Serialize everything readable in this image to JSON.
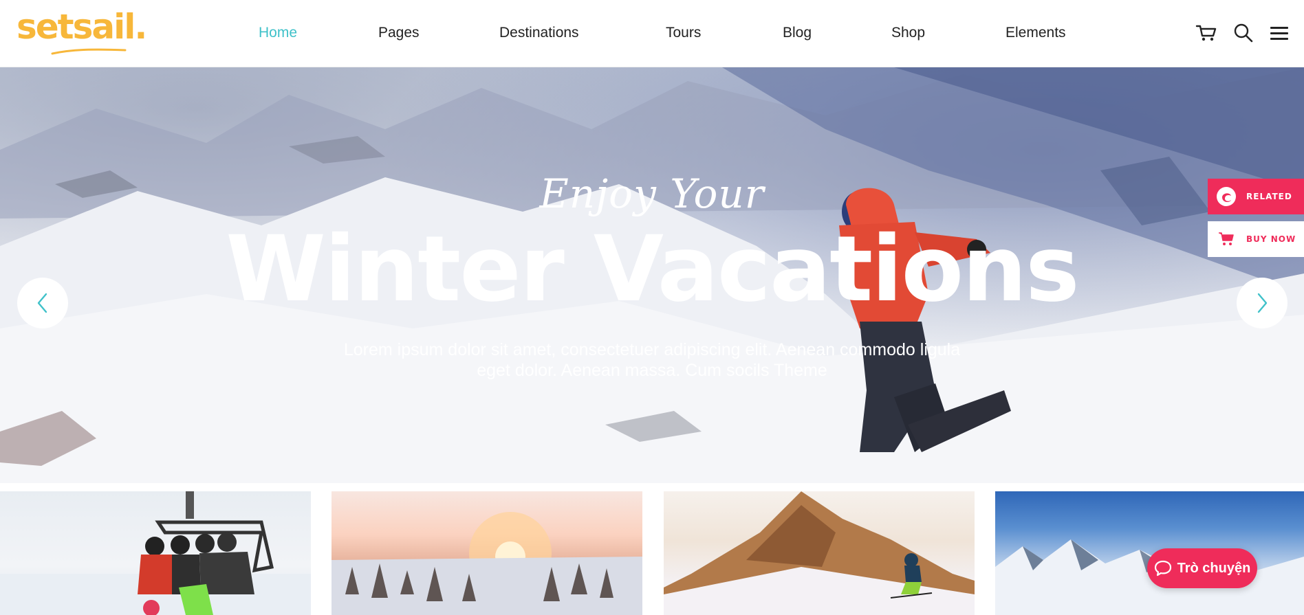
{
  "brand": {
    "logo_text": "setsail."
  },
  "nav": {
    "items": [
      {
        "label": "Home",
        "active": true
      },
      {
        "label": "Pages"
      },
      {
        "label": "Destinations"
      },
      {
        "label": "Tours"
      },
      {
        "label": "Blog"
      },
      {
        "label": "Shop"
      },
      {
        "label": "Elements"
      }
    ],
    "icons": [
      "cart-icon",
      "search-icon",
      "hamburger-menu-icon"
    ]
  },
  "hero": {
    "script_line": "Enjoy Your",
    "title": "Winter Vacations",
    "description_line1": "Lorem ipsum dolor sit amet, consectetuer adipiscing elit. Aenean commodo ligula",
    "description_line2": "eget dolor. Aenean massa. Cum socils Theme",
    "prev_icon": "chevron-left-icon",
    "next_icon": "chevron-right-icon"
  },
  "side_tabs": {
    "related_label": "RELATED",
    "buy_now_label": "BUY NOW"
  },
  "chat": {
    "label": "Trò chuyện"
  },
  "colors": {
    "accent_teal": "#3fc1c9",
    "brand_yellow": "#f7b73a",
    "accent_pink": "#ef2c5a"
  }
}
